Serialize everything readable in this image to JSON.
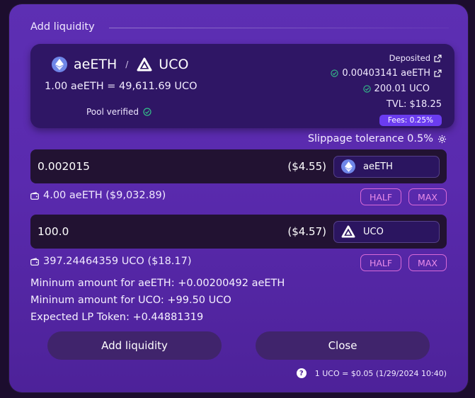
{
  "title": "Add liquidity",
  "pool": {
    "token_a": "aeETH",
    "separator": "/",
    "token_b": "UCO",
    "rate": "1.00 aeETH = 49,611.69 UCO",
    "verified_label": "Pool verified",
    "deposited_label": "Deposited",
    "deposited_a": "0.00403141 aeETH",
    "deposited_b": "200.01 UCO",
    "tvl": "TVL: $18.25",
    "fees": "Fees: 0.25%"
  },
  "slippage": "Slippage tolerance 0.5%",
  "input_a": {
    "value": "0.002015",
    "usd": "($4.55)",
    "token": "aeETH",
    "balance": "4.00 aeETH ($9,032.89)",
    "half_label": "HALF",
    "max_label": "MAX"
  },
  "input_b": {
    "value": "100.0",
    "usd": "($4.57)",
    "token": "UCO",
    "balance": "397.24464359 UCO ($18.17)",
    "half_label": "HALF",
    "max_label": "MAX"
  },
  "summary": {
    "min_a": "Mininum amount for aeETH: +0.00200492 aeETH",
    "min_b": "Mininum amount for UCO: +99.50 UCO",
    "expected": "Expected LP Token: +0.44881319"
  },
  "buttons": {
    "add_label": "Add liquidity",
    "close_label": "Close"
  },
  "footer": {
    "help": "?",
    "price": "1 UCO = $0.05 (1/29/2024 10:40)"
  },
  "icons": {
    "eth": "ethereum-icon",
    "uco": "uco-icon",
    "check": "check-circle-icon",
    "external": "external-link-icon",
    "gear": "gear-icon",
    "wallet": "wallet-icon"
  },
  "colors": {
    "accent": "#6b3cf0",
    "pill_border": "#d86ad8",
    "verified": "#33c08a"
  }
}
